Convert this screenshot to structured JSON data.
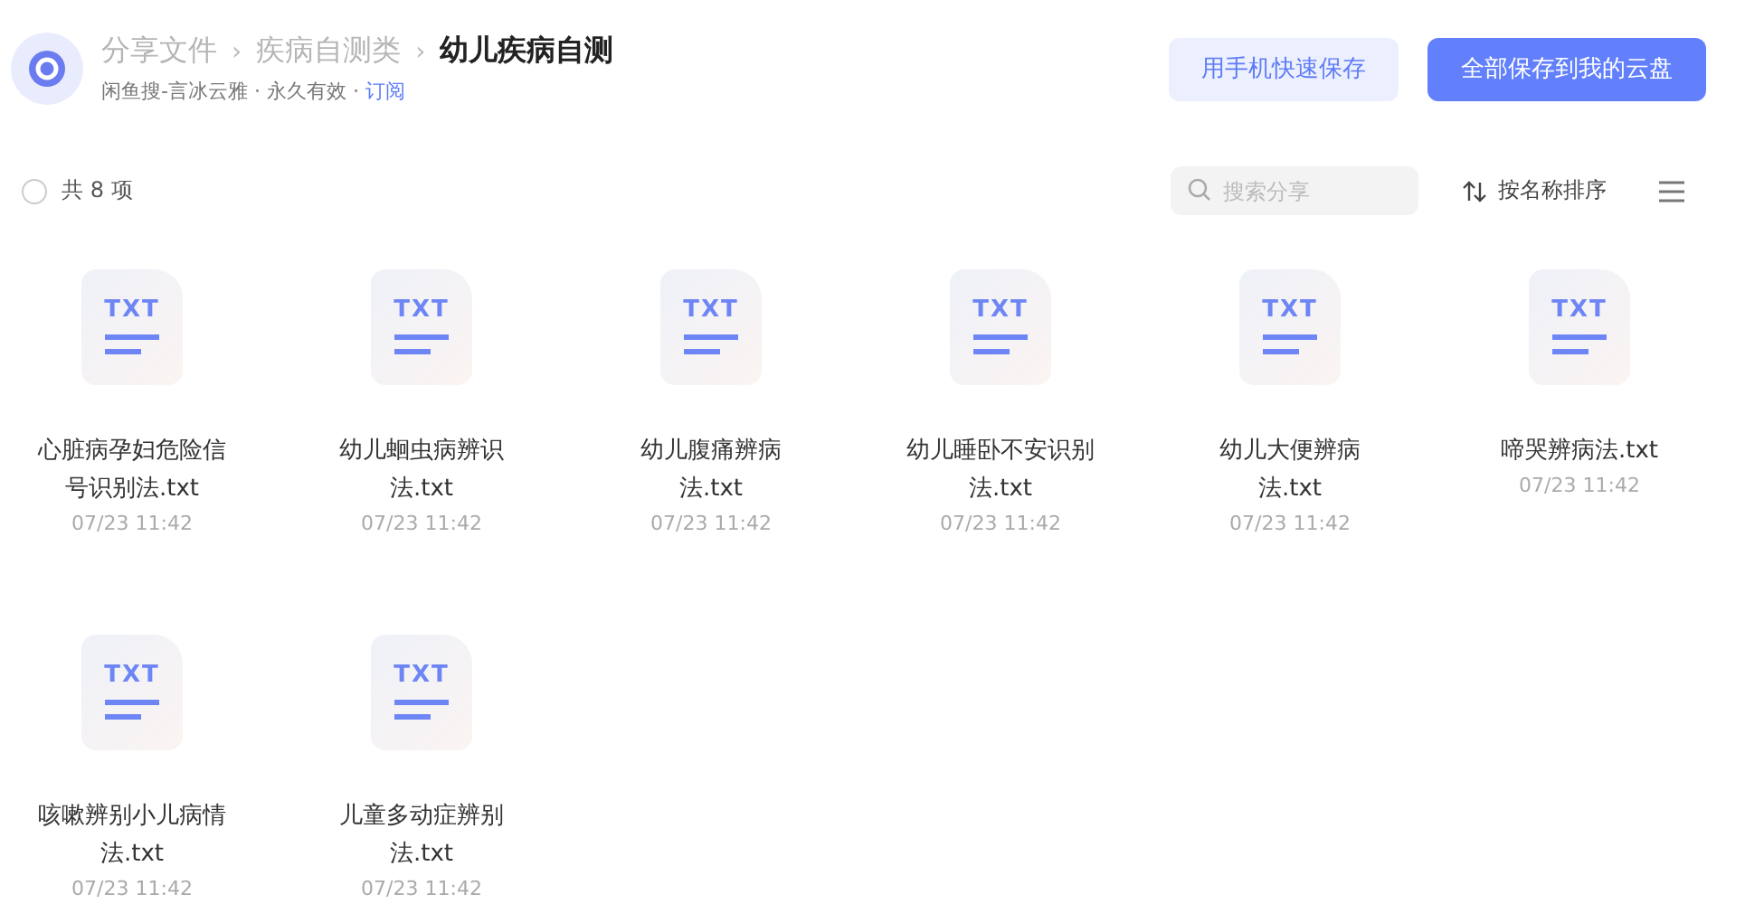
{
  "breadcrumb": [
    {
      "label": "分享文件",
      "current": false
    },
    {
      "label": "疾病自测类",
      "current": false
    },
    {
      "label": "幼儿疾病自测",
      "current": true
    }
  ],
  "breadcrumb_separator": "›",
  "meta": {
    "text": "闲鱼搜-言冰云雅 · 永久有效 · ",
    "link": "订阅"
  },
  "buttons": [
    {
      "label": "用手机快速保存",
      "kind": "secondary"
    },
    {
      "label": "全部保存到我的云盘",
      "kind": "primary"
    }
  ],
  "select_all": {
    "checked": false,
    "label": "共 8 项"
  },
  "search": {
    "placeholder": "搜索分享"
  },
  "sort": {
    "label": "按名称排序"
  },
  "files": [
    {
      "type_label": "TXT",
      "name": "心脏病孕妇危险信号识别法.txt",
      "date": "07/23 11:42"
    },
    {
      "type_label": "TXT",
      "name": "幼儿蛔虫病辨识法.txt",
      "date": "07/23 11:42"
    },
    {
      "type_label": "TXT",
      "name": "幼儿腹痛辨病法.txt",
      "date": "07/23 11:42"
    },
    {
      "type_label": "TXT",
      "name": "幼儿睡卧不安识别法.txt",
      "date": "07/23 11:42"
    },
    {
      "type_label": "TXT",
      "name": "幼儿大便辨病法.txt",
      "date": "07/23 11:42"
    },
    {
      "type_label": "TXT",
      "name": "啼哭辨病法.txt",
      "date": "07/23 11:42"
    },
    {
      "type_label": "TXT",
      "name": "咳嗽辨别小儿病情法.txt",
      "date": "07/23 11:42"
    },
    {
      "type_label": "TXT",
      "name": "儿童多动症辨别法.txt",
      "date": "07/23 11:42"
    }
  ]
}
